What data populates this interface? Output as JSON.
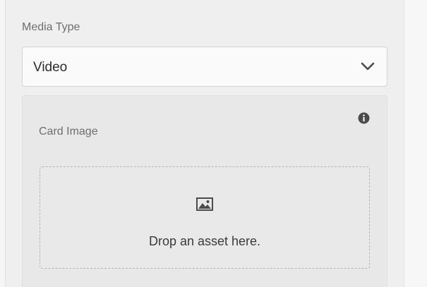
{
  "media_type": {
    "label": "Media Type",
    "selected_value": "Video"
  },
  "card_image": {
    "label": "Card Image",
    "dropzone_text": "Drop an asset here."
  },
  "icons": {
    "dropdown": "chevron-down-icon",
    "info": "info-icon",
    "asset": "image-icon"
  },
  "colors": {
    "panel_background": "#efefef",
    "card_background": "#e8e8e8",
    "text_primary": "#2c2c2c",
    "text_label": "#6e6e6e"
  }
}
